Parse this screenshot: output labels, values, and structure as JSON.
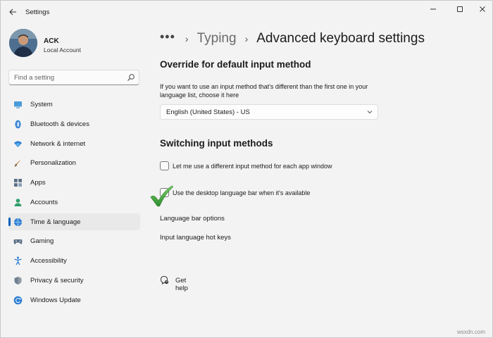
{
  "window": {
    "title": "Settings"
  },
  "user": {
    "name": "ACK",
    "account_type": "Local Account"
  },
  "search": {
    "placeholder": "Find a setting"
  },
  "nav": {
    "items": [
      {
        "label": "System",
        "icon": "monitor-icon",
        "selected": false
      },
      {
        "label": "Bluetooth & devices",
        "icon": "bluetooth-icon",
        "selected": false
      },
      {
        "label": "Network & internet",
        "icon": "wifi-icon",
        "selected": false
      },
      {
        "label": "Personalization",
        "icon": "brush-icon",
        "selected": false
      },
      {
        "label": "Apps",
        "icon": "apps-icon",
        "selected": false
      },
      {
        "label": "Accounts",
        "icon": "person-icon",
        "selected": false
      },
      {
        "label": "Time & language",
        "icon": "globe-clock-icon",
        "selected": true
      },
      {
        "label": "Gaming",
        "icon": "gamepad-icon",
        "selected": false
      },
      {
        "label": "Accessibility",
        "icon": "accessibility-icon",
        "selected": false
      },
      {
        "label": "Privacy & security",
        "icon": "shield-icon",
        "selected": false
      },
      {
        "label": "Windows Update",
        "icon": "update-icon",
        "selected": false
      }
    ]
  },
  "breadcrumb": {
    "ellipsis": "•••",
    "parent": "Typing",
    "current": "Advanced keyboard settings"
  },
  "override": {
    "title": "Override for default input method",
    "description": "If you want to use an input method that's different than the first one in your language list, choose it here",
    "dropdown_value": "English (United States) - US"
  },
  "switching": {
    "title": "Switching input methods",
    "checkbox1_label": "Let me use a different input method for each app window",
    "checkbox1_checked": false,
    "checkbox2_label": "Use the desktop language bar when it's available",
    "checkbox2_checked": true,
    "link_language_bar": "Language bar options",
    "link_hotkeys": "Input language hot keys"
  },
  "help": {
    "label": "Get help"
  },
  "watermark": "wsxdn.com",
  "colors": {
    "accent": "#005fb8",
    "check_green": "#3aa23a"
  }
}
